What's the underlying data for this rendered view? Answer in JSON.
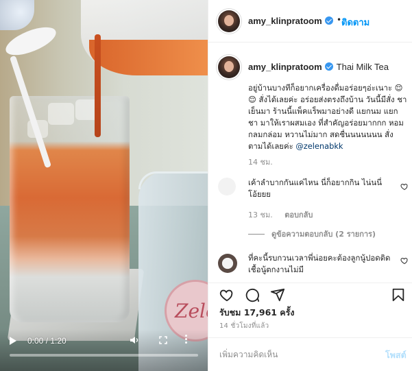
{
  "video": {
    "current_time": "0:00",
    "duration": "1:20",
    "time_display": "0:00 / 1:20",
    "progress": 0,
    "cup_brand_text": "Zele"
  },
  "post": {
    "username": "amy_klinpratoom",
    "verified": true,
    "follow_label": "ติดตาม",
    "separator": "•",
    "caption_title": "Thai Milk Tea",
    "caption_text": "อยู่บ้านบางทีก็อยากเครื่องดื่มอร่อยๆอ่ะเนาะ 😌😌 สั่งได้เลยค่ะ อร่อยส่งตรงถึงบ้าน วันนี้มีสั่ง ชาเย็นมา ร้านนี้แพ็คแร็พมาอย่างดี แยกนม แยกชา มาให้เราผสมเอง ที่สำคัญอร่อยมากกก หอม กลมกล่อม หวานไม่มาก สดชื่นนนนนนน สั่งตามได้เลยค่ะ",
    "caption_mention": "@zelenabkk",
    "caption_time": "14 ชม.",
    "comments": [
      {
        "text": "เค้าลำบากกันแค่ไหน นี่ก็อยากกิน ไน่นนี่ โอ้ยยย",
        "time": "13 ชม.",
        "reply_label": "ตอบกลับ"
      },
      {
        "text": "ที่คะนี้รบกวนเวลาพี่น่อยคะต้องลูกนู้ปอดติดเชื้อนู้ตกงานไม่มี",
        "time": "",
        "reply_label": ""
      }
    ],
    "view_replies_label": "ดูข้อความตอบกลับ (2 รายการ)",
    "likes_text": "รับชม 17,961 ครั้ง",
    "post_time": "14 ชั่วโมงที่แล้ว",
    "comment_placeholder": "เพิ่มความคิดเห็น",
    "post_label": "โพสต์"
  },
  "colors": {
    "accent_blue": "#0095f6",
    "post_disabled": "#b2dffc",
    "muted_text": "#8e8e8e",
    "mention": "#00376b"
  },
  "icons": {
    "play": "play-icon",
    "volume": "volume-icon",
    "fullscreen": "fullscreen-icon",
    "more": "more-options-icon",
    "heart": "heart-icon",
    "comment": "comment-icon",
    "share": "share-icon",
    "bookmark": "bookmark-icon"
  }
}
